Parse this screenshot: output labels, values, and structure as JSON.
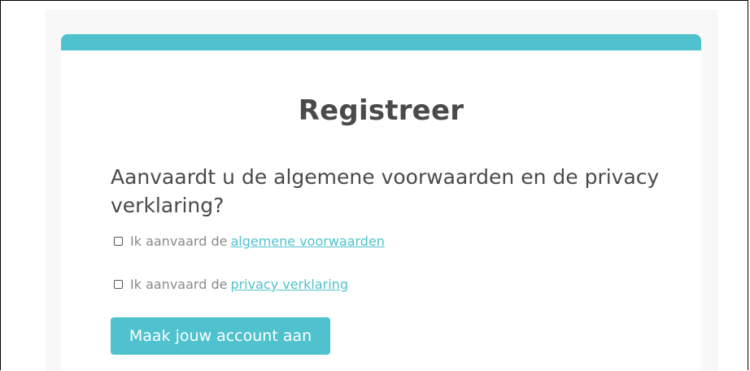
{
  "form": {
    "title": "Registreer",
    "question": "Aanvaardt u de algemene voorwaarden en de privacy verklaring?",
    "checkbox_terms": {
      "prefix": "Ik aanvaard de",
      "link_text": "algemene voorwaarden",
      "checked": false
    },
    "checkbox_privacy": {
      "prefix": "Ik aanvaard de",
      "link_text": "privacy verklaring",
      "checked": false
    },
    "submit_label": "Maak jouw account aan"
  },
  "colors": {
    "accent": "#4fc2cd",
    "text": "#4a4a4a",
    "muted": "#8a8a8a",
    "backdrop": "#f8f8f8"
  }
}
